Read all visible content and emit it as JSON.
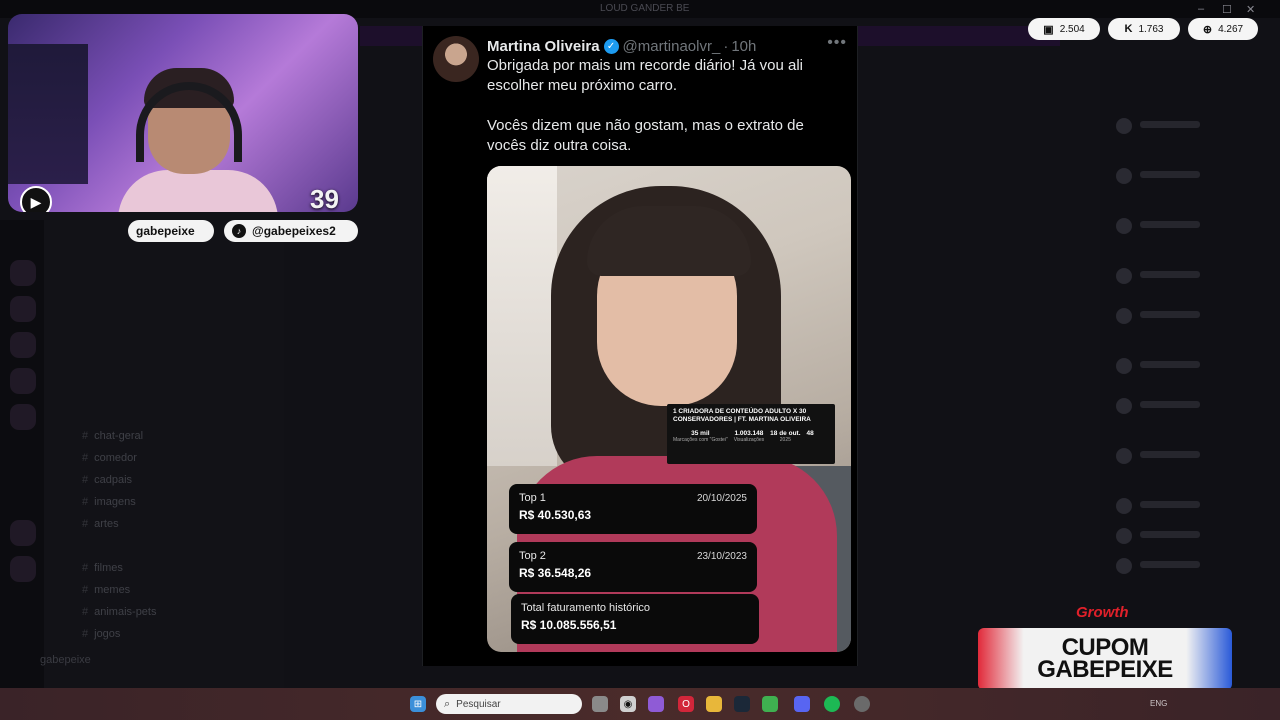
{
  "background_app": {
    "window_title": "LOUD GANDER BE",
    "window_controls": [
      "–",
      "☐",
      "✕"
    ],
    "channels": [
      "chat-geral",
      "comedor",
      "cadpais",
      "imagens",
      "artes",
      "filmes",
      "memes",
      "animais-pets",
      "jogos"
    ],
    "user": "gabepeixe"
  },
  "webcam": {
    "count": "39",
    "social_handles": [
      {
        "icon": "x-icon",
        "label": "gabepeixe"
      },
      {
        "icon": "tiktok-icon",
        "label": "@gabepeixes2"
      }
    ]
  },
  "stream_stats": [
    {
      "icon": "twitch-icon",
      "glyph": "▣",
      "value": "2.504"
    },
    {
      "icon": "kick-icon",
      "glyph": "K",
      "value": "1.763"
    },
    {
      "icon": "globe-icon",
      "glyph": "⊕",
      "value": "4.267"
    }
  ],
  "tweet": {
    "author_name": "Martina Oliveira",
    "verified_glyph": "✓",
    "handle": "@martinaolvr_",
    "separator": "·",
    "time": "10h",
    "more_glyph": "•••",
    "text_line1": "Obrigada por mais um recorde diário! Já vou ali escolher meu próximo carro.",
    "text_line2": "Vocês dizem que não gostam, mas o extrato de vocês diz outra coisa.",
    "overlay_card": {
      "title": "1 CRIADORA DE CONTEÚDO ADULTO X 30 CONSERVADORES | FT. MARTINA OLIVEIRA",
      "stats": [
        {
          "value": "35 mil",
          "label": "Marcações com \"Gostei\""
        },
        {
          "value": "1.003.148",
          "label": "Visualizações"
        },
        {
          "value": "18 de out.",
          "label": "2025"
        },
        {
          "value": "48",
          "label": ""
        }
      ]
    },
    "earnings": [
      {
        "label": "Top 1",
        "date": "20/10/2025",
        "amount": "R$ 40.530,63"
      },
      {
        "label": "Top 2",
        "date": "23/10/2023",
        "amount": "R$ 36.548,26"
      },
      {
        "label": "Total faturamento histórico",
        "date": "",
        "amount": "R$ 10.085.556,51"
      }
    ]
  },
  "sponsor": {
    "brand": "Growth",
    "line1": "CUPOM",
    "line2": "GABEPEIXE"
  },
  "taskbar": {
    "search_placeholder": "Pesquisar",
    "tray_text": "ENG"
  }
}
